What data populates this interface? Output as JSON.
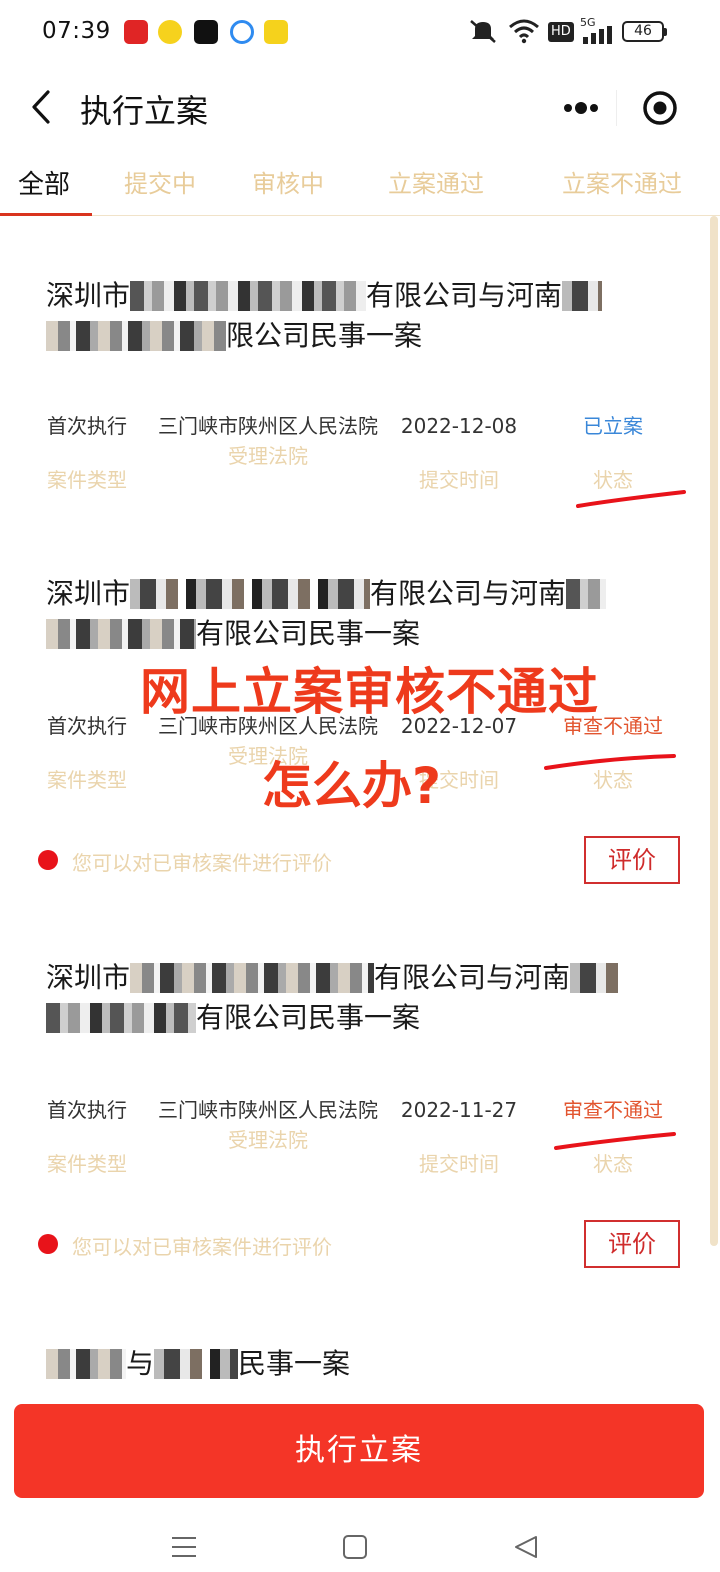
{
  "status_bar": {
    "time": "07:39",
    "network": "HD",
    "signal": "5G",
    "battery": "46"
  },
  "nav": {
    "title": "执行立案"
  },
  "tabs": [
    {
      "label": "全部",
      "active": true
    },
    {
      "label": "提交中",
      "active": false
    },
    {
      "label": "审核中",
      "active": false
    },
    {
      "label": "立案通过",
      "active": false
    },
    {
      "label": "立案不通过",
      "active": false
    }
  ],
  "labels": {
    "type": "案件类型",
    "court": "受理法院",
    "time": "提交时间",
    "status": "状态"
  },
  "cases": [
    {
      "title_a1": "深圳市",
      "title_a2": "有限公司与河南",
      "title_b": "限公司民事一案",
      "type": "首次执行",
      "court": "三门峡市陕州区人民法院",
      "date": "2022-12-08",
      "status": "已立案"
    },
    {
      "title_a1": "深圳市",
      "title_a2": "有限公司与河南",
      "title_b": "有限公司民事一案",
      "type": "首次执行",
      "court": "三门峡市陕州区人民法院",
      "date": "2022-12-07",
      "status": "审查不通过",
      "rate_text": "您可以对已审核案件进行评价",
      "rate_btn": "评价"
    },
    {
      "title_a1": "深圳市",
      "title_a2": "有限公司与河南",
      "title_b": "有限公司民事一案",
      "type": "首次执行",
      "court": "三门峡市陕州区人民法院",
      "date": "2022-11-27",
      "status": "审查不通过",
      "rate_text": "您可以对已审核案件进行评价",
      "rate_btn": "评价"
    },
    {
      "title_b1": "与",
      "title_b2": "民事一案"
    }
  ],
  "annotation": {
    "line1": "网上立案审核不通过",
    "line2": "怎么办?"
  },
  "primary_button": "执行立案",
  "colors": {
    "accent": "#f43527",
    "pass": "#3a87d8",
    "fail": "#e2552f",
    "label": "#ead4ac"
  }
}
